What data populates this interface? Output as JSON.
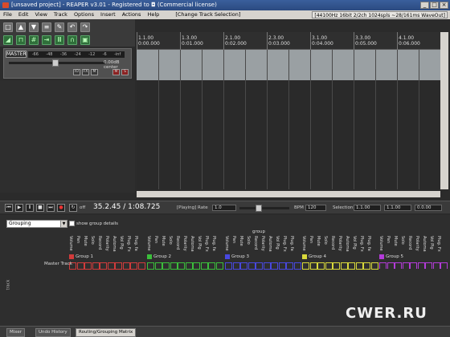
{
  "title": "[unsaved project] - REAPER v3.01 - Registered to ◘ (Commercial license)",
  "menu": [
    "File",
    "Edit",
    "View",
    "Track",
    "Options",
    "Insert",
    "Actions",
    "Help"
  ],
  "menu_status": "[Change Track Selection]",
  "audio_status": "[44100Hz 16bit 2/2ch 1024spls ~28/161ms WaveOut]",
  "master": {
    "label": "MASTER",
    "meter_ticks": [
      "-66",
      "-48",
      "-36",
      "-24",
      "-12",
      "-6",
      "-inf"
    ],
    "volume": "0.00dB center",
    "buttons": [
      "IO",
      "FX",
      "M",
      "S"
    ]
  },
  "ruler": [
    {
      "bar": "1.1.00",
      "time": "0:00.000"
    },
    {
      "bar": "1.3.00",
      "time": "0:01.000"
    },
    {
      "bar": "2.1.00",
      "time": "0:02.000"
    },
    {
      "bar": "2.3.00",
      "time": "0:03.000"
    },
    {
      "bar": "3.1.00",
      "time": "0:04.000"
    },
    {
      "bar": "3.3.00",
      "time": "0:05.000"
    },
    {
      "bar": "4.1.00",
      "time": "0:06.000"
    }
  ],
  "transport": {
    "timecode": "35.2.45 / 1:08.725",
    "repeat": "off",
    "state": "[Playing]",
    "rate_label": "Rate",
    "rate": "1.0",
    "bpm_label": "BPM",
    "bpm": "120",
    "selection_label": "Selection:",
    "sel_start": "1.1.00",
    "sel_end": "1.1.00",
    "sel_len": "0.0.00"
  },
  "matrix": {
    "dropdown": "Grouping",
    "checkbox_label": "show group details",
    "group_header": "group",
    "columns": [
      "Volume",
      "Pan",
      "Mute",
      "Solo",
      "Record",
      "Polarity",
      "Automa",
      "Vol Plg",
      "Plug. Fx",
      "Plug. fa"
    ],
    "groups": [
      {
        "name": "Group 1",
        "color": "#d23b3b"
      },
      {
        "name": "Group 2",
        "color": "#3bbf3b"
      },
      {
        "name": "Group 3",
        "color": "#4848e0"
      },
      {
        "name": "Group 4",
        "color": "#d9d93b"
      },
      {
        "name": "Group 5",
        "color": "#b43bd9"
      }
    ],
    "row_label": "Master Track",
    "side_label": "track"
  },
  "tabs": [
    "Mixer",
    "Undo History",
    "Routing/Grouping Matrix"
  ],
  "watermark": "CWER.RU"
}
